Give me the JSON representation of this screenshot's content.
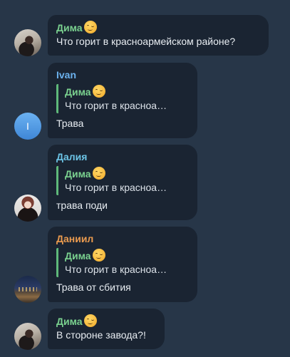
{
  "colors": {
    "background": "#273648",
    "bubble": "#1a2432",
    "reply_bar": "#5fb97a"
  },
  "messages": [
    {
      "sender": "Дима",
      "sender_color": "#7ad18f",
      "sender_emoji": "winking-face-emoji",
      "text": "Что горит в красноармейском районе?",
      "avatar": "photo"
    },
    {
      "sender": "Ivan",
      "sender_color": "#6cb2ee",
      "avatar": "letter",
      "avatar_letter": "I",
      "reply": {
        "sender": "Дима",
        "sender_emoji": "winking-face-emoji",
        "text": "Что горит в красноа…"
      },
      "text": "Трава"
    },
    {
      "sender": "Далия",
      "sender_color": "#6cc4e6",
      "avatar": "photo",
      "reply": {
        "sender": "Дима",
        "sender_emoji": "winking-face-emoji",
        "text": "Что горит в красноа…"
      },
      "text": "трава поди"
    },
    {
      "sender": "Даниил",
      "sender_color": "#eb9b4f",
      "avatar": "photo",
      "reply": {
        "sender": "Дима",
        "sender_emoji": "winking-face-emoji",
        "text": "Что горит в красноа…"
      },
      "text": "Трава от сбития"
    },
    {
      "sender": "Дима",
      "sender_color": "#7ad18f",
      "sender_emoji": "winking-face-emoji",
      "avatar": "photo",
      "text": "В стороне завода?!"
    }
  ]
}
